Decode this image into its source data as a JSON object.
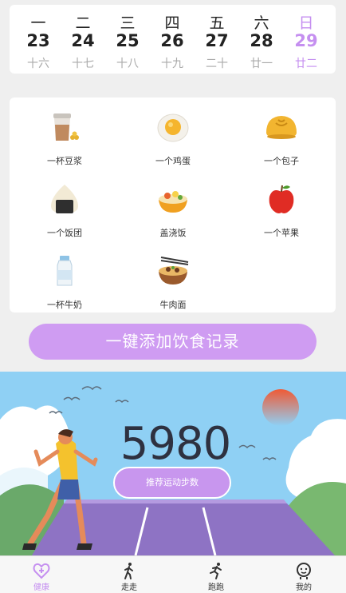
{
  "calendar": {
    "days": [
      {
        "weekday": "一",
        "date": "23",
        "lunar": "十六"
      },
      {
        "weekday": "二",
        "date": "24",
        "lunar": "十七"
      },
      {
        "weekday": "三",
        "date": "25",
        "lunar": "十八"
      },
      {
        "weekday": "四",
        "date": "26",
        "lunar": "十九"
      },
      {
        "weekday": "五",
        "date": "27",
        "lunar": "二十"
      },
      {
        "weekday": "六",
        "date": "28",
        "lunar": "廿一"
      },
      {
        "weekday": "日",
        "date": "29",
        "lunar": "廿二"
      }
    ],
    "active_index": 6,
    "active_color": "#c58ff0"
  },
  "foods": [
    {
      "label": "一杯豆浆",
      "icon": "soy-milk-icon"
    },
    {
      "label": "一个鸡蛋",
      "icon": "egg-icon"
    },
    {
      "label": "一个包子",
      "icon": "bun-icon"
    },
    {
      "label": "一个饭团",
      "icon": "rice-ball-icon"
    },
    {
      "label": "盖浇饭",
      "icon": "rice-bowl-icon"
    },
    {
      "label": "一个苹果",
      "icon": "apple-icon"
    },
    {
      "label": "一杯牛奶",
      "icon": "milk-icon"
    },
    {
      "label": "牛肉面",
      "icon": "noodles-icon"
    }
  ],
  "add_button": {
    "label": "一键添加饮食记录"
  },
  "banner": {
    "steps": "5980",
    "recommend_label": "推荐运动步数"
  },
  "tabbar": {
    "items": [
      {
        "label": "健康",
        "icon": "health-icon"
      },
      {
        "label": "走走",
        "icon": "walk-icon"
      },
      {
        "label": "跑跑",
        "icon": "run-icon"
      },
      {
        "label": "我的",
        "icon": "profile-icon"
      }
    ],
    "active_index": 0
  }
}
